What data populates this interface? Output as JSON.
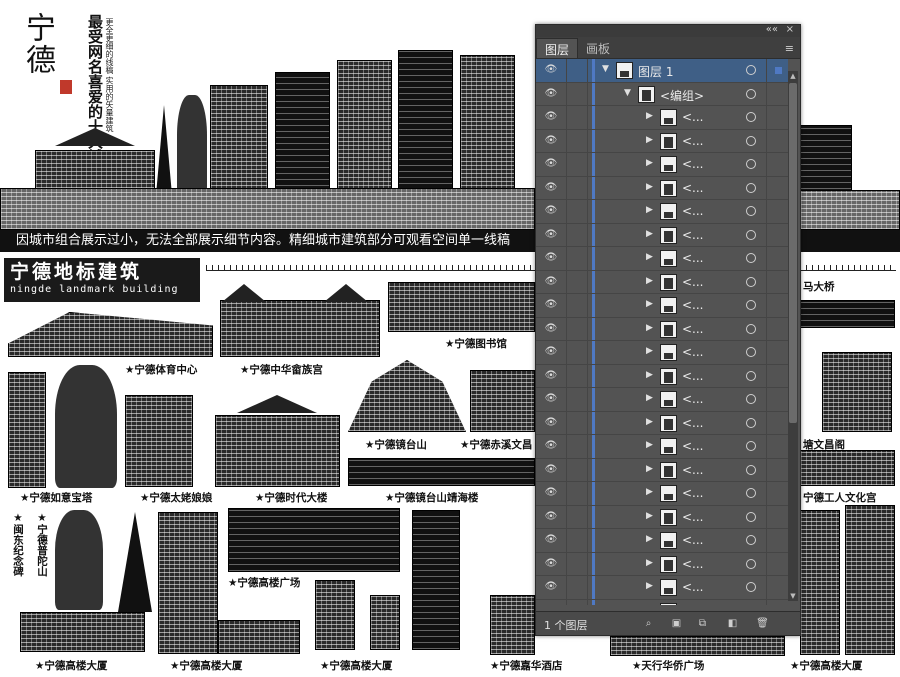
{
  "poster": {
    "city": "宁德",
    "slogan": "最受网名喜爱的十大城市",
    "subnote": "更全更细的线稿 实用的矢量建筑",
    "banner": "因城市组合展示过小，无法全部展示细节内容。精细城市建筑部分可观看空间单一线稿",
    "section_title_zh": "宁德地标建筑",
    "section_title_en": "ningde landmark building"
  },
  "captions": {
    "sports_center": "★宁德体育中心",
    "china_she": "★宁德中华畲族宫",
    "library": "★宁德图书馆",
    "bridge": "马大桥",
    "ruyi_pagoda": "★宁德如意宝塔",
    "taimu": "★宁德太姥娘娘",
    "era_tower": "★宁德时代大楼",
    "jingtai_hill": "★宁德镜台山",
    "chixi": "★宁德赤溪文昌",
    "jingtai_pavilion": "★宁德镜台山靖海楼",
    "wenchang": "塘文昌阁",
    "workers_palace": "宁德工人文化宫",
    "mindong_monument": "★闽东纪念碑",
    "putuo": "★宁德普陀山",
    "plaza": "★宁德高楼广场",
    "tower_a": "★宁德高楼大厦",
    "tower_b": "★宁德高楼大厦",
    "tower_c": "★宁德高楼大厦",
    "jiahua_hotel": "★宁德嘉华酒店",
    "tianxing": "★天行华侨广场",
    "tower_d": "★宁德高楼大厦"
  },
  "panel": {
    "tabs": [
      "图层",
      "画板"
    ],
    "active_tab": "图层",
    "top_controls": [
      "««",
      "×"
    ],
    "menu_icon": "≡",
    "layers": [
      {
        "name": "图层 1",
        "level": 0,
        "expanded": true,
        "selected": true
      },
      {
        "name": "<编组>",
        "level": 1,
        "expanded": true,
        "selected": false
      },
      {
        "name": "<...",
        "level": 2
      },
      {
        "name": "<...",
        "level": 2
      },
      {
        "name": "<...",
        "level": 2
      },
      {
        "name": "<...",
        "level": 2
      },
      {
        "name": "<...",
        "level": 2
      },
      {
        "name": "<...",
        "level": 2
      },
      {
        "name": "<...",
        "level": 2
      },
      {
        "name": "<...",
        "level": 2
      },
      {
        "name": "<...",
        "level": 2
      },
      {
        "name": "<...",
        "level": 2
      },
      {
        "name": "<...",
        "level": 2
      },
      {
        "name": "<...",
        "level": 2
      },
      {
        "name": "<...",
        "level": 2
      },
      {
        "name": "<...",
        "level": 2
      },
      {
        "name": "<...",
        "level": 2
      },
      {
        "name": "<...",
        "level": 2
      },
      {
        "name": "<...",
        "level": 2
      },
      {
        "name": "<...",
        "level": 2
      },
      {
        "name": "<...",
        "level": 2
      },
      {
        "name": "<...",
        "level": 2
      },
      {
        "name": "<...",
        "level": 2
      },
      {
        "name": "<...",
        "level": 2
      }
    ],
    "footer_count": "1 个图层",
    "footer_buttons": [
      "locate-object",
      "make-clipping-mask",
      "create-sublayer",
      "create-new-layer",
      "delete-layer"
    ]
  }
}
